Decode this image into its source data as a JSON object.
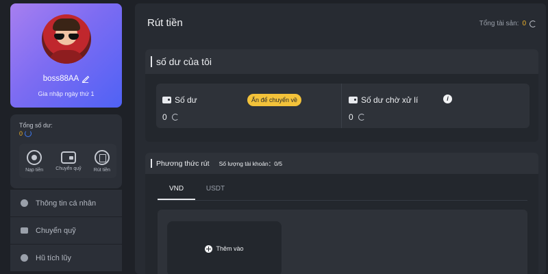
{
  "profile": {
    "username": "boss88AA",
    "join_text": "Gia nhập ngày thứ 1"
  },
  "wallet_summary": {
    "total_label": "Tổng số dư:",
    "total_value": "0",
    "actions": [
      {
        "label": "Nạp tiền",
        "icon": "deposit-icon"
      },
      {
        "label": "Chuyển quỹ",
        "icon": "wallet-icon"
      },
      {
        "label": "Rút tiền",
        "icon": "withdraw-icon"
      }
    ]
  },
  "side_menu": [
    {
      "label": "Thông tin cá nhân",
      "icon": "user-icon"
    },
    {
      "label": "Chuyển quỹ",
      "icon": "wallet-icon"
    },
    {
      "label": "Hũ tích lũy",
      "icon": "savings-icon"
    }
  ],
  "header": {
    "title": "Rút tiền",
    "total_assets_label": "Tổng tài sản:",
    "total_assets_value": "0"
  },
  "balance_section": {
    "title": "số dư của tôi",
    "balance_label": "Số dư",
    "balance_value": "0",
    "transfer_badge": "Ấn để chuyển về",
    "pending_label": "Số dư chờ xử lí",
    "pending_value": "0"
  },
  "withdraw_section": {
    "title": "Phương thức rút",
    "account_count": "Số lượng tài khoản：0/5",
    "tabs": [
      "VND",
      "USDT"
    ],
    "active_tab": "VND",
    "add_label": "Thêm vào"
  },
  "colors": {
    "accent_yellow": "#f3c23a",
    "background": "#1e2127",
    "panel": "#272b32",
    "profile_gradient": [
      "#a77ff0",
      "#4f62f5"
    ]
  }
}
